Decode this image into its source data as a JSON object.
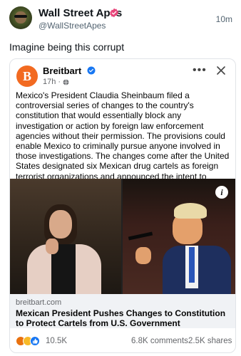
{
  "post": {
    "author_name": "Wall Street Apes",
    "handle": "@WallStreetApes",
    "time": "10m",
    "text": "Imagine being this corrupt"
  },
  "embed": {
    "page_name": "Breitbart",
    "logo_letter": "B",
    "time": "17h",
    "separator": "·",
    "body": "Mexico's President Claudia Sheinbaum filed a controversial series of changes to the country's constitution that would essentially block any investigation or action by foreign law enforcement agencies without their permission. The provisions could enable Mexico to criminally pursue anyone involved in those investigations. The changes come after the United States designated six Mexican drug cartels as foreign terrorist organizations and announced the intent to eradicate them.",
    "more_label": "•••",
    "info_label": "i",
    "link_domain": "breitbart.com",
    "link_title": "Mexican President Pushes Changes to Constitution to Protect Cartels from U.S. Government",
    "reaction_count": "10.5K",
    "comments": "6.8K comments",
    "shares": "2.5K shares"
  },
  "colors": {
    "pink_verified": "#e8457a",
    "blue_verified": "#1877f2",
    "breitbart_orange": "#f26a21"
  },
  "icons": {
    "verified_pink": "verified-badge-icon",
    "verified_blue": "verified-badge-icon",
    "globe": "globe-icon",
    "close": "close-icon",
    "more": "more-options-icon",
    "info": "info-icon"
  }
}
